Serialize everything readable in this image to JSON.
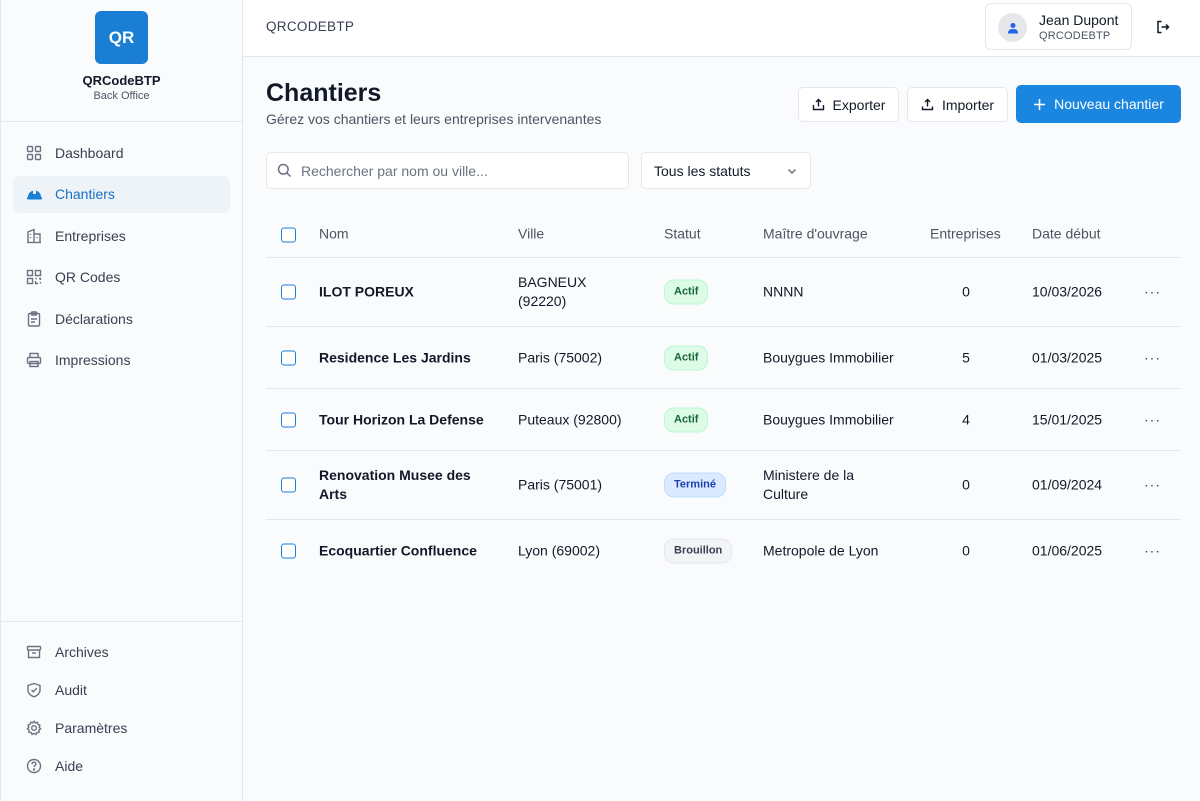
{
  "brand": {
    "logo_text": "QR",
    "name": "QRCodeBTP",
    "subtitle": "Back Office"
  },
  "sidebar": {
    "items": [
      {
        "label": "Dashboard",
        "icon": "grid-icon",
        "active": false
      },
      {
        "label": "Chantiers",
        "icon": "hard-hat-icon",
        "active": true
      },
      {
        "label": "Entreprises",
        "icon": "building-icon",
        "active": false
      },
      {
        "label": "QR Codes",
        "icon": "qr-code-icon",
        "active": false
      },
      {
        "label": "Déclarations",
        "icon": "clipboard-icon",
        "active": false
      },
      {
        "label": "Impressions",
        "icon": "printer-icon",
        "active": false
      }
    ],
    "bottom_items": [
      {
        "label": "Archives",
        "icon": "archive-icon"
      },
      {
        "label": "Audit",
        "icon": "shield-check-icon"
      },
      {
        "label": "Paramètres",
        "icon": "gear-icon"
      },
      {
        "label": "Aide",
        "icon": "help-circle-icon"
      }
    ]
  },
  "topbar": {
    "title": "QRCODEBTP",
    "user": {
      "name": "Jean Dupont",
      "org": "QRCODEBTP"
    }
  },
  "page": {
    "title": "Chantiers",
    "subtitle": "Gérez vos chantiers et leurs entreprises intervenantes",
    "export_label": "Exporter",
    "import_label": "Importer",
    "new_label": "Nouveau chantier"
  },
  "filters": {
    "search_placeholder": "Rechercher par nom ou ville...",
    "search_value": "",
    "status_selected": "Tous les statuts"
  },
  "table": {
    "headers": {
      "nom": "Nom",
      "ville": "Ville",
      "statut": "Statut",
      "maitre": "Maître d'ouvrage",
      "entreprises": "Entreprises",
      "date": "Date début"
    },
    "rows": [
      {
        "nom": "ILOT POREUX",
        "ville": "BAGNEUX (92220)",
        "statut": "Actif",
        "statut_kind": "actif",
        "maitre": "NNNN",
        "entreprises": "0",
        "date": "10/03/2026",
        "more": "···"
      },
      {
        "nom": "Residence Les Jardins",
        "ville": "Paris (75002)",
        "statut": "Actif",
        "statut_kind": "actif",
        "maitre": "Bouygues Immobilier",
        "entreprises": "5",
        "date": "01/03/2025",
        "more": "···"
      },
      {
        "nom": "Tour Horizon La Defense",
        "ville": "Puteaux (92800)",
        "statut": "Actif",
        "statut_kind": "actif",
        "maitre": "Bouygues Immobilier",
        "entreprises": "4",
        "date": "15/01/2025",
        "more": "···"
      },
      {
        "nom": "Renovation Musee des Arts",
        "ville": "Paris (75001)",
        "statut": "Terminé",
        "statut_kind": "termine",
        "maitre": "Ministere de la Culture",
        "entreprises": "0",
        "date": "01/09/2024",
        "more": "···"
      },
      {
        "nom": "Ecoquartier Confluence",
        "ville": "Lyon (69002)",
        "statut": "Brouillon",
        "statut_kind": "brouillon",
        "maitre": "Metropole de Lyon",
        "entreprises": "0",
        "date": "01/06/2025",
        "more": "···"
      }
    ]
  },
  "colors": {
    "accent": "#1a86e0",
    "active_bg": "#eef3f8"
  }
}
